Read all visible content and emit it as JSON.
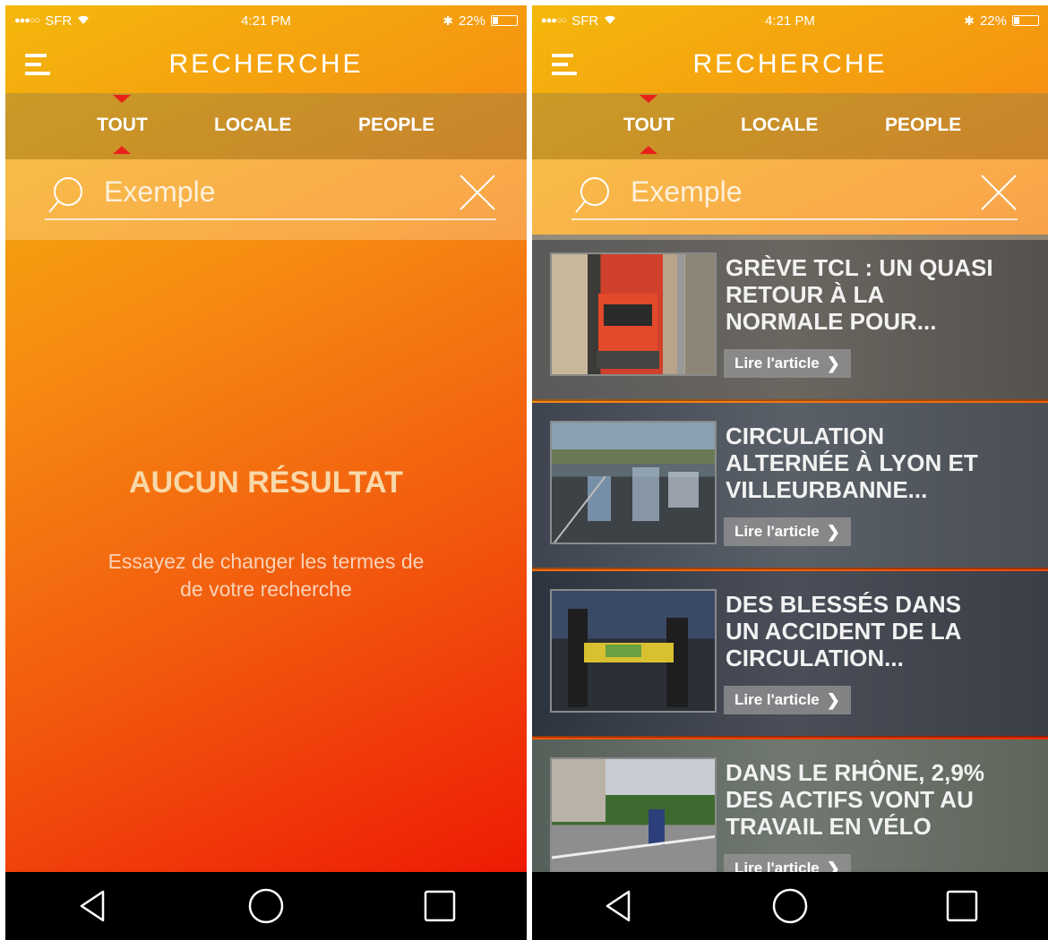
{
  "screens": [
    {
      "status_bar": {
        "carrier": "SFR",
        "time": "4:21 PM",
        "battery": "22%"
      },
      "header": {
        "title": "RECHERCHE"
      },
      "tabs": [
        {
          "label": "TOUT"
        },
        {
          "label": "LOCALE"
        },
        {
          "label": "PEOPLE"
        }
      ],
      "active_tab": "TOUT",
      "search": {
        "placeholder": "Exemple"
      },
      "empty_state": {
        "title": "AUCUN RÉSULTAT",
        "line1": "Essayez de changer les termes de",
        "line2": "de votre recherche"
      }
    },
    {
      "status_bar": {
        "carrier": "SFR",
        "time": "4:21 PM",
        "battery": "22%"
      },
      "header": {
        "title": "RECHERCHE"
      },
      "tabs": [
        {
          "label": "TOUT"
        },
        {
          "label": "LOCALE"
        },
        {
          "label": "PEOPLE"
        }
      ],
      "active_tab": "TOUT",
      "search": {
        "placeholder": "Exemple"
      },
      "results": [
        {
          "title_line1": "GRÈVE TCL : UN QUASI",
          "title_line2": "RETOUR À LA",
          "title_line3": "NORMALE POUR...",
          "button": "Lire l'article"
        },
        {
          "title_line1": "CIRCULATION",
          "title_line2": "ALTERNÉE À LYON ET",
          "title_line3": "VILLEURBANNE...",
          "button": "Lire l'article"
        },
        {
          "title_line1": "DES BLESSÉS DANS",
          "title_line2": "UN ACCIDENT DE LA",
          "title_line3": "CIRCULATION...",
          "button": "Lire l'article"
        },
        {
          "title_line1": "DANS LE RHÔNE, 2,9%",
          "title_line2": "DES ACTIFS VONT AU",
          "title_line3": "TRAVAIL EN VÉLO",
          "button": "Lire l'article"
        }
      ]
    }
  ],
  "icons": {
    "menu": "hamburger-menu-icon",
    "search": "search-icon",
    "clear": "close-icon",
    "nav": [
      "back-triangle-icon",
      "home-circle-icon",
      "recents-square-icon"
    ]
  },
  "colors": {
    "gradient_start": "#f4b80c",
    "gradient_end": "#ee1a04",
    "tab_indicator": "#e8221a",
    "empty_title": "#f9d8a8"
  }
}
